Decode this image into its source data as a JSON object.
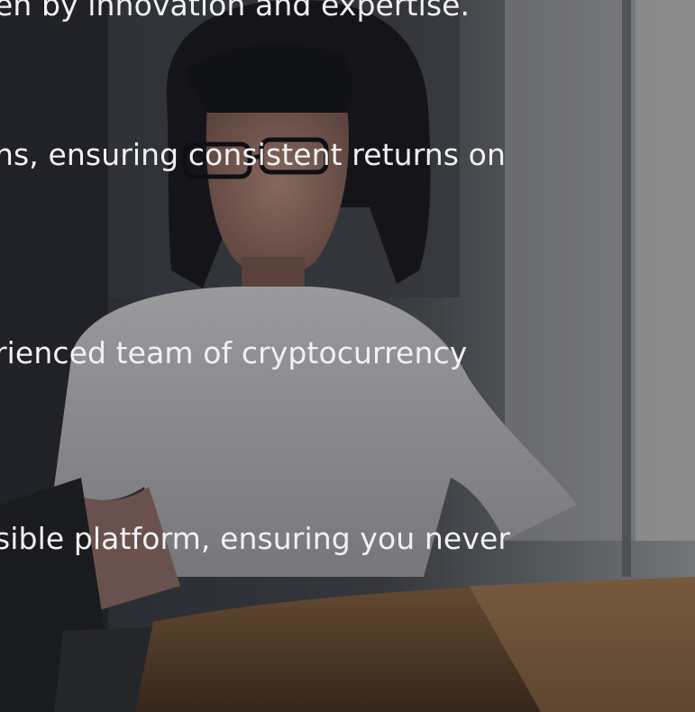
{
  "hero": {
    "background_image": "woman-with-glasses-working-on-laptop-photo",
    "overlay_color": "#121218"
  },
  "content": {
    "lines": [
      "en by innovation and expertise.",
      "ns, ensuring consistent returns on",
      "rienced team of cryptocurrency",
      "sible platform, ensuring you never"
    ]
  }
}
